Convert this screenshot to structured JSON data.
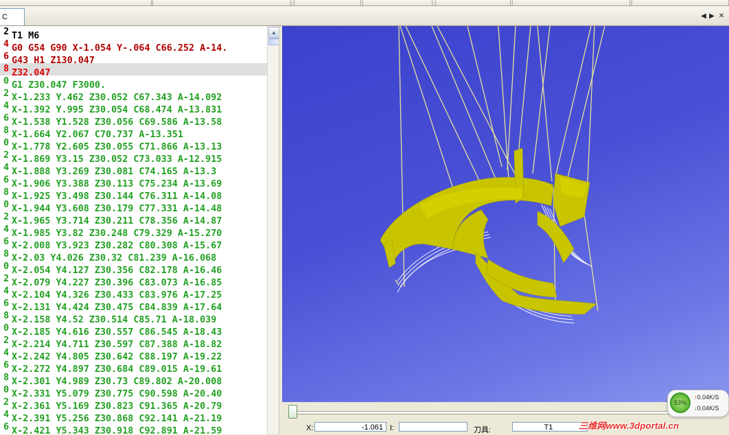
{
  "tabs": {
    "active_label": "C",
    "prev_glyph": "◀",
    "next_glyph": "▶",
    "close_glyph": "✕"
  },
  "code_lines": [
    {
      "ln": "2",
      "text": "T1 M6",
      "color": "#000000"
    },
    {
      "ln": "4",
      "text": "G0 G54 G90 X-1.054 Y-.064 C66.252 A-14.",
      "color": "#b00000"
    },
    {
      "ln": "6",
      "text": "G43 H1 Z130.047",
      "color": "#b00000"
    },
    {
      "ln": "8",
      "text": "Z32.047",
      "color": "#dd0000",
      "selected": true
    },
    {
      "ln": "0",
      "text": "G1 Z30.047 F3000.",
      "color": "#22a022"
    },
    {
      "ln": "2",
      "text": "X-1.233 Y.462 Z30.052 C67.343 A-14.092",
      "color": "#22a022"
    },
    {
      "ln": "4",
      "text": "X-1.392 Y.995 Z30.054 C68.474 A-13.831",
      "color": "#22a022"
    },
    {
      "ln": "6",
      "text": "X-1.538 Y1.528 Z30.056 C69.586 A-13.58",
      "color": "#22a022"
    },
    {
      "ln": "8",
      "text": "X-1.664 Y2.067 C70.737 A-13.351",
      "color": "#22a022"
    },
    {
      "ln": "0",
      "text": "X-1.778 Y2.605 Z30.055 C71.866 A-13.13",
      "color": "#22a022"
    },
    {
      "ln": "2",
      "text": "X-1.869 Y3.15 Z30.052 C73.033 A-12.915",
      "color": "#22a022"
    },
    {
      "ln": "4",
      "text": "X-1.888 Y3.269 Z30.081 C74.165 A-13.3",
      "color": "#22a022"
    },
    {
      "ln": "6",
      "text": "X-1.906 Y3.388 Z30.113 C75.234 A-13.69",
      "color": "#22a022"
    },
    {
      "ln": "8",
      "text": "X-1.925 Y3.498 Z30.144 C76.311 A-14.08",
      "color": "#22a022"
    },
    {
      "ln": "0",
      "text": "X-1.944 Y3.608 Z30.179 C77.331 A-14.48",
      "color": "#22a022"
    },
    {
      "ln": "2",
      "text": "X-1.965 Y3.714 Z30.211 C78.356 A-14.87",
      "color": "#22a022"
    },
    {
      "ln": "4",
      "text": "X-1.985 Y3.82 Z30.248 C79.329 A-15.270",
      "color": "#22a022"
    },
    {
      "ln": "6",
      "text": "X-2.008 Y3.923 Z30.282 C80.308 A-15.67",
      "color": "#22a022"
    },
    {
      "ln": "8",
      "text": "X-2.03 Y4.026 Z30.32 C81.239 A-16.068",
      "color": "#22a022"
    },
    {
      "ln": "0",
      "text": "X-2.054 Y4.127 Z30.356 C82.178 A-16.46",
      "color": "#22a022"
    },
    {
      "ln": "2",
      "text": "X-2.079 Y4.227 Z30.396 C83.073 A-16.85",
      "color": "#22a022"
    },
    {
      "ln": "4",
      "text": "X-2.104 Y4.326 Z30.433 C83.976 A-17.25",
      "color": "#22a022"
    },
    {
      "ln": "6",
      "text": "X-2.131 Y4.424 Z30.475 C84.839 A-17.64",
      "color": "#22a022"
    },
    {
      "ln": "8",
      "text": "X-2.158 Y4.52 Z30.514 C85.71 A-18.039",
      "color": "#22a022"
    },
    {
      "ln": "0",
      "text": "X-2.185 Y4.616 Z30.557 C86.545 A-18.43",
      "color": "#22a022"
    },
    {
      "ln": "2",
      "text": "X-2.214 Y4.711 Z30.597 C87.388 A-18.82",
      "color": "#22a022"
    },
    {
      "ln": "4",
      "text": "X-2.242 Y4.805 Z30.642 C88.197 A-19.22",
      "color": "#22a022"
    },
    {
      "ln": "6",
      "text": "X-2.272 Y4.897 Z30.684 C89.015 A-19.61",
      "color": "#22a022"
    },
    {
      "ln": "8",
      "text": "X-2.301 Y4.989 Z30.73 C89.802 A-20.008",
      "color": "#22a022"
    },
    {
      "ln": "0",
      "text": "X-2.331 Y5.079 Z30.775 C90.598 A-20.40",
      "color": "#22a022"
    },
    {
      "ln": "2",
      "text": "X-2.361 Y5.169 Z30.823 C91.365 A-20.79",
      "color": "#22a022"
    },
    {
      "ln": "4",
      "text": "X-2.391 Y5.256 Z30.868 C92.141 A-21.19",
      "color": "#22a022"
    },
    {
      "ln": "6",
      "text": "X-2.421 Y5.343 Z30.918 C92.891 A-21.59",
      "color": "#22a022"
    }
  ],
  "status": {
    "x_label": "X:",
    "x_value": "-1.061",
    "i_label": "I:",
    "i_value": "",
    "tool_label": "刀具:",
    "tool_value": "T1"
  },
  "net": {
    "percent": "53%",
    "up_rate": "0.04K/S",
    "down_rate": "0.04K/S",
    "up_glyph": "↑",
    "down_glyph": "↓"
  },
  "watermark": "三维网www.3dportal.cn",
  "colors": {
    "viewport_bg": "#4a51d6",
    "part_fill": "#c8c400",
    "toolpath": "#e6e19a"
  }
}
